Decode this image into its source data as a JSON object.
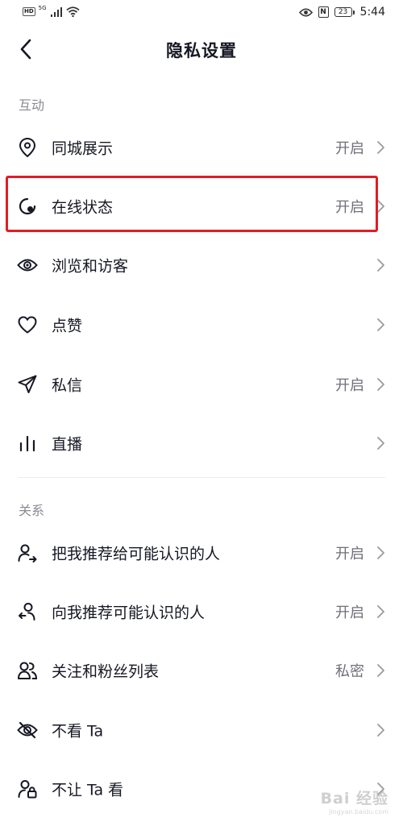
{
  "status_bar": {
    "hd": "HD",
    "network": "5G",
    "nfc": "N",
    "battery": "23",
    "time": "5:44"
  },
  "header": {
    "title": "隐私设置"
  },
  "sections": {
    "interaction": {
      "title": "互动"
    },
    "relation": {
      "title": "关系"
    }
  },
  "rows": [
    {
      "label": "同城展示",
      "value": "开启",
      "icon": "location-pin-icon"
    },
    {
      "label": "在线状态",
      "value": "开启",
      "icon": "online-status-icon"
    },
    {
      "label": "浏览和访客",
      "value": "",
      "icon": "eye-icon"
    },
    {
      "label": "点赞",
      "value": "",
      "icon": "heart-icon"
    },
    {
      "label": "私信",
      "value": "开启",
      "icon": "paper-plane-icon"
    },
    {
      "label": "直播",
      "value": "",
      "icon": "live-bars-icon"
    },
    {
      "label": "把我推荐给可能认识的人",
      "value": "开启",
      "icon": "user-share-icon"
    },
    {
      "label": "向我推荐可能认识的人",
      "value": "开启",
      "icon": "user-recommend-icon"
    },
    {
      "label": "关注和粉丝列表",
      "value": "私密",
      "icon": "users-icon"
    },
    {
      "label": "不看 Ta",
      "value": "",
      "icon": "eye-off-icon"
    },
    {
      "label": "不让 Ta 看",
      "value": "",
      "icon": "user-lock-icon"
    }
  ],
  "watermark": {
    "text": "Bai 经验",
    "sub": "jingyan.baidu.com"
  },
  "colors": {
    "highlight": "#e31b23",
    "text": "#161823",
    "secondary": "#6f7078",
    "section": "#8a8b91"
  }
}
